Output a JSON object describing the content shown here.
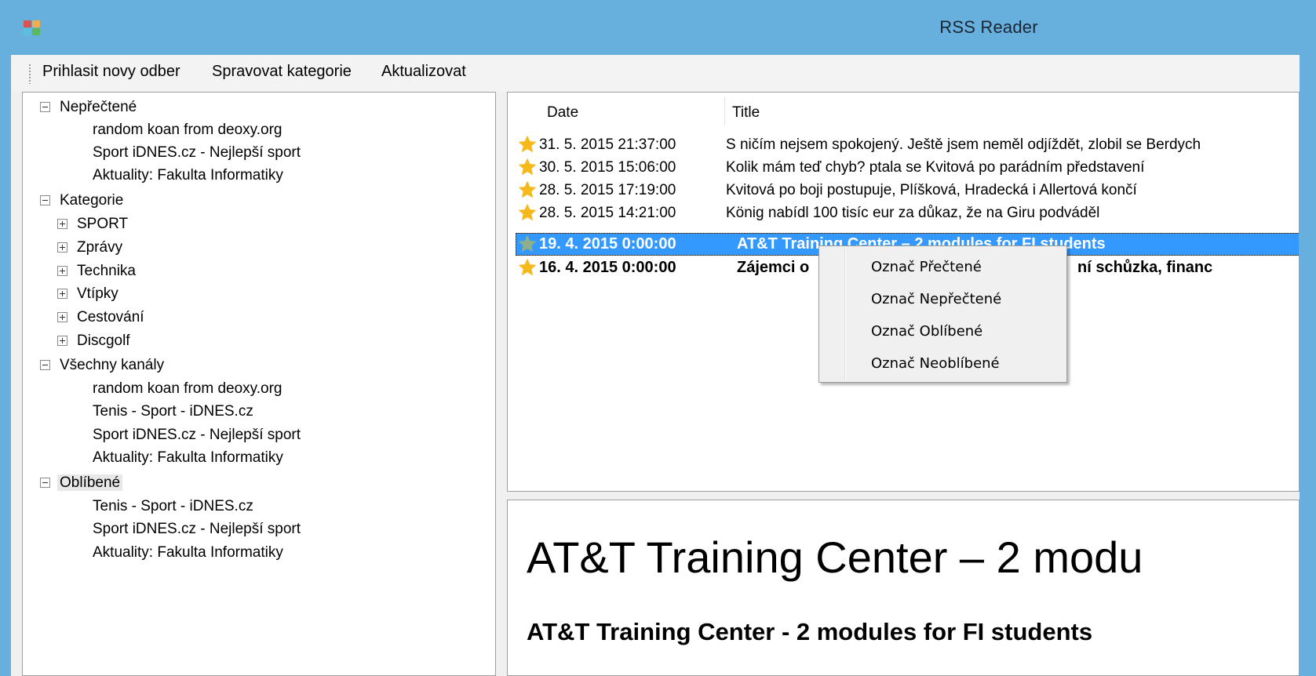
{
  "window": {
    "title": "RSS Reader"
  },
  "toolbar": {
    "items": [
      {
        "label": "Prihlasit novy odber"
      },
      {
        "label": "Spravovat kategorie"
      },
      {
        "label": "Aktualizovat"
      }
    ]
  },
  "tree": {
    "unread": {
      "label": "Nepřečtené",
      "children": [
        "random koan from deoxy.org",
        "Sport iDNES.cz - Nejlepší sport",
        "Aktuality: Fakulta Informatiky"
      ]
    },
    "categories": {
      "label": "Kategorie",
      "children": [
        "SPORT",
        "Zprávy",
        "Technika",
        "Vtípky",
        "Cestování",
        "Discgolf"
      ]
    },
    "all_channels": {
      "label": "Všechny kanály",
      "children": [
        "random koan from deoxy.org",
        "Tenis - Sport - iDNES.cz",
        "Sport iDNES.cz - Nejlepší sport",
        "Aktuality: Fakulta Informatiky"
      ]
    },
    "favorites": {
      "label": "Oblíbené",
      "children": [
        "Tenis - Sport - iDNES.cz",
        "Sport iDNES.cz - Nejlepší sport",
        "Aktuality: Fakulta Informatiky"
      ]
    }
  },
  "article_list": {
    "columns": {
      "date": "Date",
      "title": "Title"
    },
    "rows": [
      {
        "date": "31. 5. 2015 21:37:00",
        "title": "S ničím nejsem spokojený. Ještě jsem neměl odjíždět, zlobil se Berdych"
      },
      {
        "date": "30. 5. 2015 15:06:00",
        "title": "Kolik mám teď chyb? ptala se Kvitová po parádním představení"
      },
      {
        "date": "28. 5. 2015 17:19:00",
        "title": "Kvitová po boji postupuje, Plíšková, Hradecká i Allertová končí"
      },
      {
        "date": "28. 5. 2015 14:21:00",
        "title": "König nabídl 100 tisíc eur za důkaz, že na Giru podváděl"
      },
      {
        "date": "19. 4. 2015 0:00:00",
        "title": "AT&T Training Center – 2 modules for FI students"
      },
      {
        "date": "16. 4. 2015 0:00:00",
        "title": "Zájemci o",
        "title_tail": "ní schůzka, financ"
      }
    ]
  },
  "context_menu": {
    "items": [
      "Označ Přečtené",
      "Označ Nepřečtené",
      "Označ Oblíbené",
      "Označ Neoblíbené"
    ]
  },
  "article_view": {
    "title": "AT&T Training Center – 2 modu",
    "subtitle": "AT&T Training Center - 2 modules for FI students"
  },
  "colors": {
    "titlebar": "#67b0de",
    "selection": "#3399ff",
    "star_favorite": "#f6b91b",
    "star_unfavorite": "#8fae8a"
  }
}
